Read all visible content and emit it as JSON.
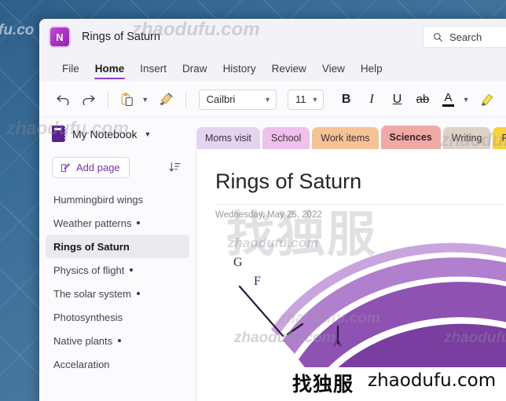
{
  "window": {
    "app_icon": "onenote-logo-icon",
    "app_icon_letter": "N",
    "title": "Rings of Saturn"
  },
  "search": {
    "icon": "search-icon",
    "placeholder": "Search",
    "label": "Search"
  },
  "menubar": {
    "items": [
      {
        "label": "File",
        "active": false
      },
      {
        "label": "Home",
        "active": true
      },
      {
        "label": "Insert",
        "active": false
      },
      {
        "label": "Draw",
        "active": false
      },
      {
        "label": "History",
        "active": false
      },
      {
        "label": "Review",
        "active": false
      },
      {
        "label": "View",
        "active": false
      },
      {
        "label": "Help",
        "active": false
      }
    ]
  },
  "toolbar": {
    "undo": "undo-icon",
    "redo": "redo-icon",
    "paste": "paste-icon",
    "paste_chevron": "chevron-down-icon",
    "format_painter": "format-painter-icon",
    "font_name": "Cailbri",
    "font_size": "11",
    "bold": "B",
    "italic": "I",
    "underline": "U",
    "strikethrough": "ab",
    "font_color": "A",
    "font_color_chevron": "chevron-down-icon",
    "highlight": "highlighter-icon",
    "combo_chevron": "chevron-down-icon"
  },
  "notebook": {
    "icon": "notebook-icon",
    "name": "My Notebook",
    "chevron": "chevron-down-icon"
  },
  "section_tabs": [
    {
      "label": "Moms visit",
      "color": "#e3d5ef",
      "active": false
    },
    {
      "label": "School",
      "color": "#eec0ea",
      "active": false
    },
    {
      "label": "Work items",
      "color": "#f5c396",
      "active": false
    },
    {
      "label": "Sciences",
      "color": "#f0aaa6",
      "active": true
    },
    {
      "label": "Writing",
      "color": "#ded2c7",
      "active": false
    },
    {
      "label": "Rec",
      "color": "#f7d23e",
      "active": false
    }
  ],
  "sidebar": {
    "add_page": {
      "label": "Add page",
      "icon": "edit-page-icon"
    },
    "sort_icon": "sort-descending-icon",
    "pages": [
      {
        "label": "Hummingbird wings",
        "dot": false,
        "selected": false
      },
      {
        "label": "Weather patterns",
        "dot": true,
        "selected": false
      },
      {
        "label": "Rings of Saturn",
        "dot": false,
        "selected": true
      },
      {
        "label": "Physics of flight",
        "dot": true,
        "selected": false
      },
      {
        "label": "The solar system",
        "dot": true,
        "selected": false
      },
      {
        "label": "Photosynthesis",
        "dot": false,
        "selected": false
      },
      {
        "label": "Native plants",
        "dot": true,
        "selected": false
      },
      {
        "label": "Accelaration",
        "dot": false,
        "selected": false
      }
    ]
  },
  "page": {
    "title": "Rings of Saturn",
    "date": "Wednesday, May 25, 2022",
    "figure": {
      "name": "saturn-rings-diagram",
      "labels": [
        "G",
        "F",
        "A"
      ],
      "ring_colors": [
        "#c9a5dd",
        "#b589cf",
        "#9b63bc",
        "#8a4fae",
        "#7a3da0"
      ]
    }
  },
  "watermarks": {
    "domain": "zhaodufu.com",
    "chinese": "找独服",
    "partial_left": "fu.co"
  },
  "accent_colors": {
    "purple": "#8b41c4",
    "onenote": "#a831bf",
    "section_active": "#f0aaa6"
  }
}
